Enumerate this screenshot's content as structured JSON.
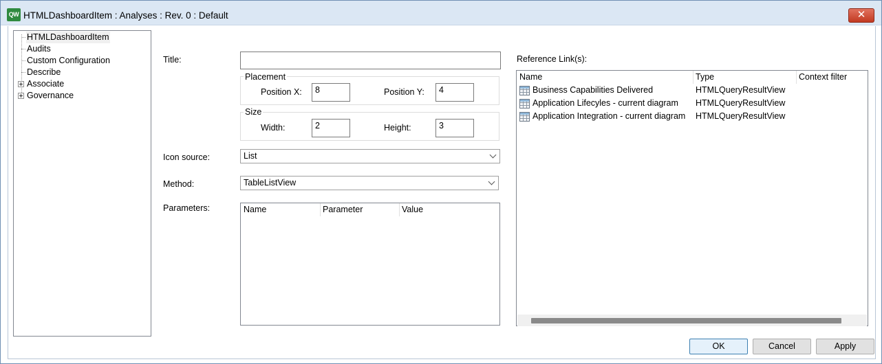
{
  "window": {
    "title": "HTMLDashboardItem : Analyses : Rev. 0  : Default",
    "app_icon_text": "QW",
    "close_glyph": "✕"
  },
  "tree": {
    "items": [
      {
        "label": "HTMLDashboardItem",
        "selected": true,
        "expandable": false
      },
      {
        "label": "Audits",
        "expandable": false
      },
      {
        "label": "Custom Configuration",
        "expandable": false
      },
      {
        "label": "Describe",
        "expandable": false
      },
      {
        "label": "Associate",
        "expandable": true
      },
      {
        "label": "Governance",
        "expandable": true
      }
    ]
  },
  "form": {
    "title_label": "Title:",
    "title_value": "",
    "placement": {
      "group_label": "Placement",
      "x_label": "Position X:",
      "x_value": "8",
      "y_label": "Position Y:",
      "y_value": "4"
    },
    "size": {
      "group_label": "Size",
      "width_label": "Width:",
      "width_value": "2",
      "height_label": "Height:",
      "height_value": "3"
    },
    "icon_source_label": "Icon source:",
    "icon_source_value": "List",
    "method_label": "Method:",
    "method_value": "TableListView",
    "parameters_label": "Parameters:",
    "parameters_columns": [
      "Name",
      "Parameter",
      "Value"
    ]
  },
  "reference_links": {
    "label": "Reference Link(s):",
    "columns": [
      "Name",
      "Type",
      "Context filter"
    ],
    "rows": [
      {
        "name": "Business Capabilities Delivered",
        "type": "HTMLQueryResultView",
        "icon": "table-grid-icon"
      },
      {
        "name": "Application Lifecyles - current diagram",
        "type": "HTMLQueryResultView",
        "icon": "table-grid-icon"
      },
      {
        "name": "Application Integration - current diagram",
        "type": "HTMLQueryResultView",
        "icon": "table-grid-icon"
      }
    ]
  },
  "buttons": {
    "ok": "OK",
    "cancel": "Cancel",
    "apply": "Apply"
  },
  "colors": {
    "titlebar": "#dbe7f4",
    "close_button": "#c23a21",
    "app_icon": "#2f8a3f",
    "default_button_border": "#3c7fb1"
  }
}
